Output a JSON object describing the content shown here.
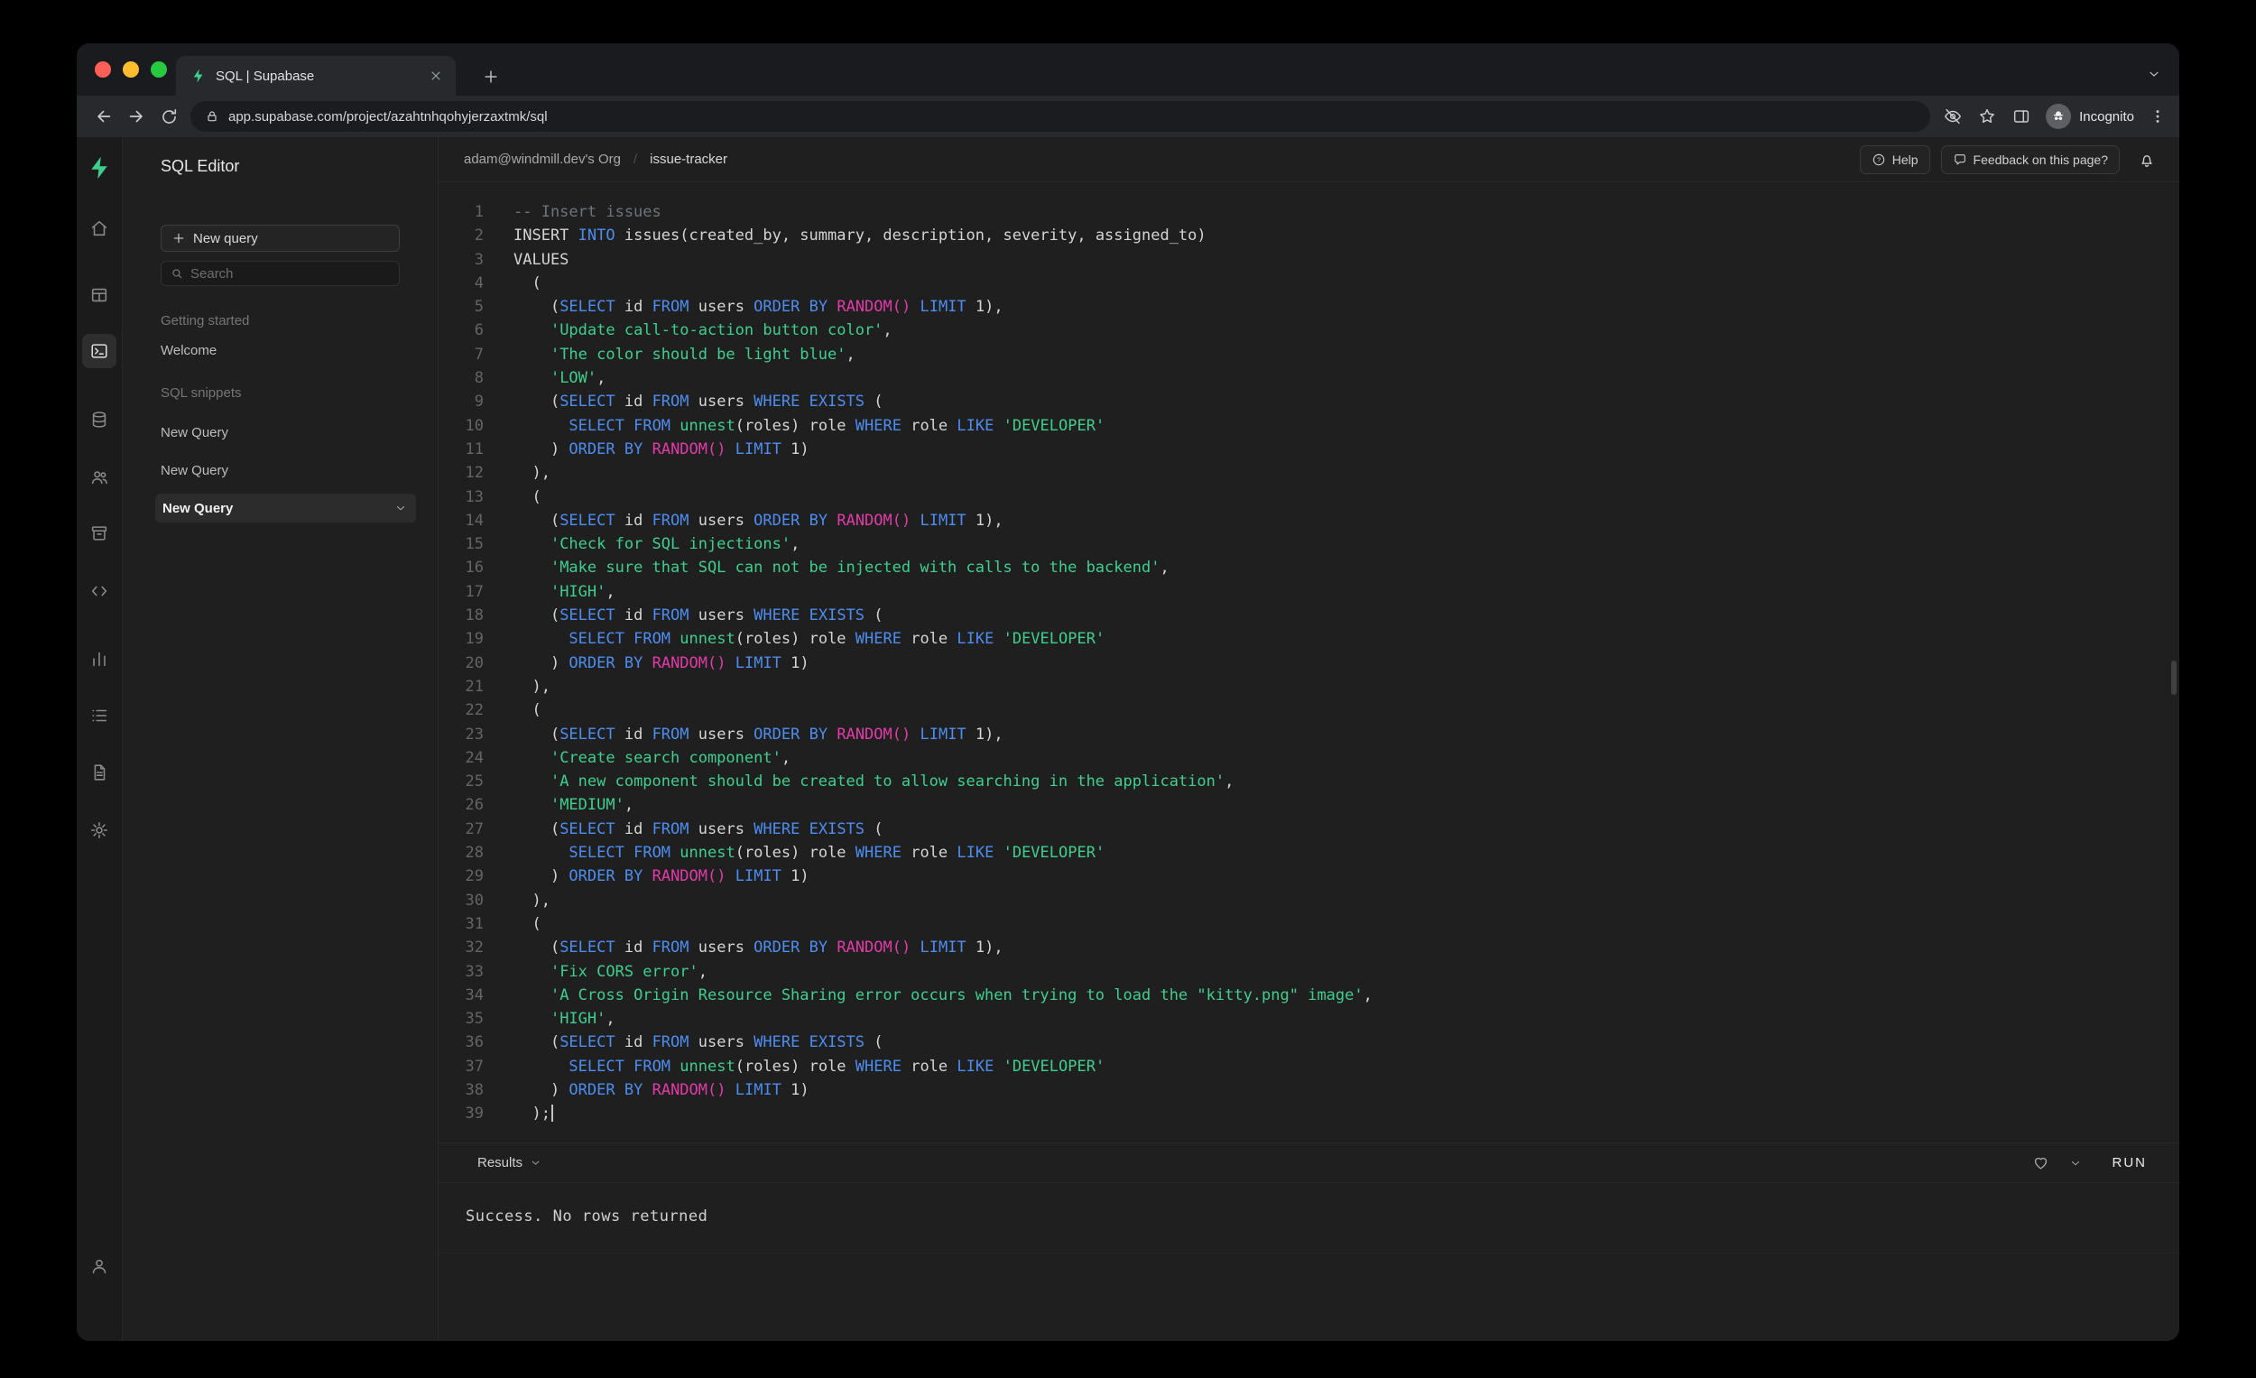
{
  "browser": {
    "tab_title": "SQL | Supabase",
    "url": "app.supabase.com/project/azahtnhqohyjerzaxtmk/sql",
    "incognito_label": "Incognito"
  },
  "rail": {
    "items": [
      {
        "name": "home"
      },
      {
        "name": "table-editor"
      },
      {
        "name": "sql-editor",
        "selected": true
      },
      {
        "name": "database"
      },
      {
        "name": "authentication"
      },
      {
        "name": "storage"
      },
      {
        "name": "functions"
      },
      {
        "name": "reports"
      },
      {
        "name": "logs"
      },
      {
        "name": "docs"
      },
      {
        "name": "settings"
      }
    ],
    "bottom": {
      "name": "account"
    }
  },
  "sidebar": {
    "title": "SQL Editor",
    "new_query_button": "New query",
    "search_placeholder": "Search",
    "sections": [
      {
        "label": "Getting started",
        "items": [
          {
            "label": "Welcome"
          }
        ]
      },
      {
        "label": "SQL snippets",
        "items": [
          {
            "label": "New Query"
          },
          {
            "label": "New Query"
          },
          {
            "label": "New Query",
            "selected": true
          }
        ]
      }
    ]
  },
  "header": {
    "breadcrumb_org": "adam@windmill.dev's Org",
    "breadcrumb_separator": "/",
    "breadcrumb_project": "issue-tracker",
    "help_label": "Help",
    "feedback_label": "Feedback on this page?"
  },
  "results": {
    "label": "Results",
    "run_label": "RUN",
    "message": "Success. No rows returned"
  },
  "colors": {
    "accent_green": "#3ecf8e",
    "keyword_blue": "#4d8df0",
    "function_magenta": "#e23ba9",
    "string_green": "#3ecf8e",
    "comment_gray": "#6d747e"
  },
  "editor": {
    "line_count": 39,
    "lines": [
      [
        [
          "cm",
          "-- Insert issues"
        ]
      ],
      [
        [
          "pl",
          "INSERT "
        ],
        [
          "kw",
          "INTO"
        ],
        [
          "pl",
          " issues(created_by, summary, description, severity, assigned_to)"
        ]
      ],
      [
        [
          "pl",
          "VALUES"
        ]
      ],
      [
        [
          "pl",
          "  ("
        ]
      ],
      [
        [
          "pl",
          "    ("
        ],
        [
          "kw",
          "SELECT"
        ],
        [
          "pl",
          " id "
        ],
        [
          "kw",
          "FROM"
        ],
        [
          "pl",
          " users "
        ],
        [
          "kw",
          "ORDER"
        ],
        [
          "pl",
          " "
        ],
        [
          "kw",
          "BY"
        ],
        [
          "pl",
          " "
        ],
        [
          "fn",
          "RANDOM()"
        ],
        [
          "pl",
          " "
        ],
        [
          "kw",
          "LIMIT"
        ],
        [
          "pl",
          " 1),"
        ]
      ],
      [
        [
          "pl",
          "    "
        ],
        [
          "str",
          "'Update call-to-action button color'"
        ],
        [
          "pl",
          ","
        ]
      ],
      [
        [
          "pl",
          "    "
        ],
        [
          "str",
          "'The color should be light blue'"
        ],
        [
          "pl",
          ","
        ]
      ],
      [
        [
          "pl",
          "    "
        ],
        [
          "str",
          "'LOW'"
        ],
        [
          "pl",
          ","
        ]
      ],
      [
        [
          "pl",
          "    ("
        ],
        [
          "kw",
          "SELECT"
        ],
        [
          "pl",
          " id "
        ],
        [
          "kw",
          "FROM"
        ],
        [
          "pl",
          " users "
        ],
        [
          "kw",
          "WHERE"
        ],
        [
          "pl",
          " "
        ],
        [
          "kw",
          "EXISTS"
        ],
        [
          "pl",
          " ("
        ]
      ],
      [
        [
          "pl",
          "      "
        ],
        [
          "kw",
          "SELECT"
        ],
        [
          "pl",
          " "
        ],
        [
          "kw",
          "FROM"
        ],
        [
          "pl",
          " "
        ],
        [
          "str",
          "unnest"
        ],
        [
          "pl",
          "(roles) role "
        ],
        [
          "kw",
          "WHERE"
        ],
        [
          "pl",
          " role "
        ],
        [
          "kw",
          "LIKE"
        ],
        [
          "pl",
          " "
        ],
        [
          "str",
          "'DEVELOPER'"
        ]
      ],
      [
        [
          "pl",
          "    ) "
        ],
        [
          "kw",
          "ORDER"
        ],
        [
          "pl",
          " "
        ],
        [
          "kw",
          "BY"
        ],
        [
          "pl",
          " "
        ],
        [
          "fn",
          "RANDOM()"
        ],
        [
          "pl",
          " "
        ],
        [
          "kw",
          "LIMIT"
        ],
        [
          "pl",
          " 1)"
        ]
      ],
      [
        [
          "pl",
          "  ),"
        ]
      ],
      [
        [
          "pl",
          "  ("
        ]
      ],
      [
        [
          "pl",
          "    ("
        ],
        [
          "kw",
          "SELECT"
        ],
        [
          "pl",
          " id "
        ],
        [
          "kw",
          "FROM"
        ],
        [
          "pl",
          " users "
        ],
        [
          "kw",
          "ORDER"
        ],
        [
          "pl",
          " "
        ],
        [
          "kw",
          "BY"
        ],
        [
          "pl",
          " "
        ],
        [
          "fn",
          "RANDOM()"
        ],
        [
          "pl",
          " "
        ],
        [
          "kw",
          "LIMIT"
        ],
        [
          "pl",
          " 1),"
        ]
      ],
      [
        [
          "pl",
          "    "
        ],
        [
          "str",
          "'Check for SQL injections'"
        ],
        [
          "pl",
          ","
        ]
      ],
      [
        [
          "pl",
          "    "
        ],
        [
          "str",
          "'Make sure that SQL can not be injected with calls to the backend'"
        ],
        [
          "pl",
          ","
        ]
      ],
      [
        [
          "pl",
          "    "
        ],
        [
          "str",
          "'HIGH'"
        ],
        [
          "pl",
          ","
        ]
      ],
      [
        [
          "pl",
          "    ("
        ],
        [
          "kw",
          "SELECT"
        ],
        [
          "pl",
          " id "
        ],
        [
          "kw",
          "FROM"
        ],
        [
          "pl",
          " users "
        ],
        [
          "kw",
          "WHERE"
        ],
        [
          "pl",
          " "
        ],
        [
          "kw",
          "EXISTS"
        ],
        [
          "pl",
          " ("
        ]
      ],
      [
        [
          "pl",
          "      "
        ],
        [
          "kw",
          "SELECT"
        ],
        [
          "pl",
          " "
        ],
        [
          "kw",
          "FROM"
        ],
        [
          "pl",
          " "
        ],
        [
          "str",
          "unnest"
        ],
        [
          "pl",
          "(roles) role "
        ],
        [
          "kw",
          "WHERE"
        ],
        [
          "pl",
          " role "
        ],
        [
          "kw",
          "LIKE"
        ],
        [
          "pl",
          " "
        ],
        [
          "str",
          "'DEVELOPER'"
        ]
      ],
      [
        [
          "pl",
          "    ) "
        ],
        [
          "kw",
          "ORDER"
        ],
        [
          "pl",
          " "
        ],
        [
          "kw",
          "BY"
        ],
        [
          "pl",
          " "
        ],
        [
          "fn",
          "RANDOM()"
        ],
        [
          "pl",
          " "
        ],
        [
          "kw",
          "LIMIT"
        ],
        [
          "pl",
          " 1)"
        ]
      ],
      [
        [
          "pl",
          "  ),"
        ]
      ],
      [
        [
          "pl",
          "  ("
        ]
      ],
      [
        [
          "pl",
          "    ("
        ],
        [
          "kw",
          "SELECT"
        ],
        [
          "pl",
          " id "
        ],
        [
          "kw",
          "FROM"
        ],
        [
          "pl",
          " users "
        ],
        [
          "kw",
          "ORDER"
        ],
        [
          "pl",
          " "
        ],
        [
          "kw",
          "BY"
        ],
        [
          "pl",
          " "
        ],
        [
          "fn",
          "RANDOM()"
        ],
        [
          "pl",
          " "
        ],
        [
          "kw",
          "LIMIT"
        ],
        [
          "pl",
          " 1),"
        ]
      ],
      [
        [
          "pl",
          "    "
        ],
        [
          "str",
          "'Create search component'"
        ],
        [
          "pl",
          ","
        ]
      ],
      [
        [
          "pl",
          "    "
        ],
        [
          "str",
          "'A new component should be created to allow searching in the application'"
        ],
        [
          "pl",
          ","
        ]
      ],
      [
        [
          "pl",
          "    "
        ],
        [
          "str",
          "'MEDIUM'"
        ],
        [
          "pl",
          ","
        ]
      ],
      [
        [
          "pl",
          "    ("
        ],
        [
          "kw",
          "SELECT"
        ],
        [
          "pl",
          " id "
        ],
        [
          "kw",
          "FROM"
        ],
        [
          "pl",
          " users "
        ],
        [
          "kw",
          "WHERE"
        ],
        [
          "pl",
          " "
        ],
        [
          "kw",
          "EXISTS"
        ],
        [
          "pl",
          " ("
        ]
      ],
      [
        [
          "pl",
          "      "
        ],
        [
          "kw",
          "SELECT"
        ],
        [
          "pl",
          " "
        ],
        [
          "kw",
          "FROM"
        ],
        [
          "pl",
          " "
        ],
        [
          "str",
          "unnest"
        ],
        [
          "pl",
          "(roles) role "
        ],
        [
          "kw",
          "WHERE"
        ],
        [
          "pl",
          " role "
        ],
        [
          "kw",
          "LIKE"
        ],
        [
          "pl",
          " "
        ],
        [
          "str",
          "'DEVELOPER'"
        ]
      ],
      [
        [
          "pl",
          "    ) "
        ],
        [
          "kw",
          "ORDER"
        ],
        [
          "pl",
          " "
        ],
        [
          "kw",
          "BY"
        ],
        [
          "pl",
          " "
        ],
        [
          "fn",
          "RANDOM()"
        ],
        [
          "pl",
          " "
        ],
        [
          "kw",
          "LIMIT"
        ],
        [
          "pl",
          " 1)"
        ]
      ],
      [
        [
          "pl",
          "  ),"
        ]
      ],
      [
        [
          "pl",
          "  ("
        ]
      ],
      [
        [
          "pl",
          "    ("
        ],
        [
          "kw",
          "SELECT"
        ],
        [
          "pl",
          " id "
        ],
        [
          "kw",
          "FROM"
        ],
        [
          "pl",
          " users "
        ],
        [
          "kw",
          "ORDER"
        ],
        [
          "pl",
          " "
        ],
        [
          "kw",
          "BY"
        ],
        [
          "pl",
          " "
        ],
        [
          "fn",
          "RANDOM()"
        ],
        [
          "pl",
          " "
        ],
        [
          "kw",
          "LIMIT"
        ],
        [
          "pl",
          " 1),"
        ]
      ],
      [
        [
          "pl",
          "    "
        ],
        [
          "str",
          "'Fix CORS error'"
        ],
        [
          "pl",
          ","
        ]
      ],
      [
        [
          "pl",
          "    "
        ],
        [
          "str",
          "'A Cross Origin Resource Sharing error occurs when trying to load the \"kitty.png\" image'"
        ],
        [
          "pl",
          ","
        ]
      ],
      [
        [
          "pl",
          "    "
        ],
        [
          "str",
          "'HIGH'"
        ],
        [
          "pl",
          ","
        ]
      ],
      [
        [
          "pl",
          "    ("
        ],
        [
          "kw",
          "SELECT"
        ],
        [
          "pl",
          " id "
        ],
        [
          "kw",
          "FROM"
        ],
        [
          "pl",
          " users "
        ],
        [
          "kw",
          "WHERE"
        ],
        [
          "pl",
          " "
        ],
        [
          "kw",
          "EXISTS"
        ],
        [
          "pl",
          " ("
        ]
      ],
      [
        [
          "pl",
          "      "
        ],
        [
          "kw",
          "SELECT"
        ],
        [
          "pl",
          " "
        ],
        [
          "kw",
          "FROM"
        ],
        [
          "pl",
          " "
        ],
        [
          "str",
          "unnest"
        ],
        [
          "pl",
          "(roles) role "
        ],
        [
          "kw",
          "WHERE"
        ],
        [
          "pl",
          " role "
        ],
        [
          "kw",
          "LIKE"
        ],
        [
          "pl",
          " "
        ],
        [
          "str",
          "'DEVELOPER'"
        ]
      ],
      [
        [
          "pl",
          "    ) "
        ],
        [
          "kw",
          "ORDER"
        ],
        [
          "pl",
          " "
        ],
        [
          "kw",
          "BY"
        ],
        [
          "pl",
          " "
        ],
        [
          "fn",
          "RANDOM()"
        ],
        [
          "pl",
          " "
        ],
        [
          "kw",
          "LIMIT"
        ],
        [
          "pl",
          " 1)"
        ]
      ],
      [
        [
          "pl",
          "  );"
        ],
        [
          "caret",
          ""
        ]
      ]
    ]
  }
}
